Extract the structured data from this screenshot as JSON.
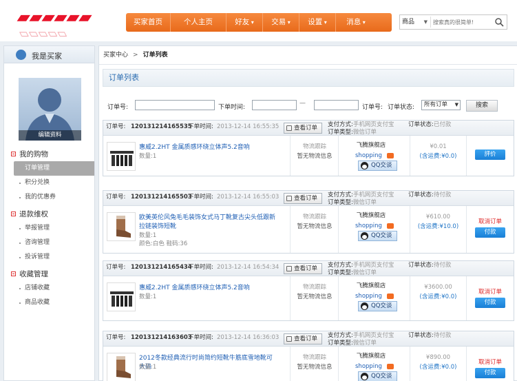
{
  "header": {
    "nav": [
      {
        "label": "买家首页",
        "dropdown": false
      },
      {
        "label": "个人主页",
        "dropdown": false
      },
      {
        "label": "好友",
        "dropdown": true
      },
      {
        "label": "交易",
        "dropdown": true
      },
      {
        "label": "设置",
        "dropdown": true
      },
      {
        "label": "消息",
        "dropdown": true
      }
    ],
    "search": {
      "scope": "商品",
      "placeholder": "搜索真的很简单!"
    }
  },
  "sidebar": {
    "title": "我是买家",
    "avatar_edit": "编辑资料",
    "groups": [
      {
        "label": "我的购物",
        "items": [
          "订单管理",
          "积分兑换",
          "我的优惠券"
        ]
      },
      {
        "label": "退款维权",
        "items": [
          "举报管理",
          "咨询管理",
          "投诉管理"
        ]
      },
      {
        "label": "收藏管理",
        "items": [
          "店铺收藏",
          "商品收藏"
        ]
      }
    ]
  },
  "breadcrumb": {
    "parent": "买家中心",
    "separator": ">",
    "current": "订单列表"
  },
  "page_title": "订单列表",
  "filter": {
    "order_no_label": "订单号:",
    "time_label": "下单时间:",
    "range_sep": "—",
    "order_no2_label": "订单号:",
    "status_label": "订单状态:",
    "status_value": "所有订单",
    "search_button": "搜索"
  },
  "labels": {
    "order_no": "订单号:",
    "order_time": "下单时间:",
    "view_order": "查看订单",
    "pay_method": "支付方式:",
    "order_type": "订单类型:",
    "order_status": "订单状态:",
    "logistics_track": "物流跟踪",
    "no_logistics": "暂无物流信息",
    "qq": "QQ交谈",
    "shopping": "shopping",
    "qty_prefix": "数量:",
    "cancel": "取消订单",
    "pay": "付款",
    "extra_action": "評价"
  },
  "orders": [
    {
      "no": "120131214165535",
      "time": "2013-12-14 16:55:35",
      "pay": "手机网页支付宝",
      "type": "微信订单",
      "status": "已付款",
      "product": "惠威2.2HT 金属质感环绕立体声5.2音响",
      "qty": "1",
      "extra": "",
      "shop": "飞腾旗舰店",
      "price": "¥0.01",
      "shipping": "(含运费:¥0.0)",
      "state": "paid"
    },
    {
      "no": "120131214165503",
      "time": "2013-12-14 16:55:03",
      "pay": "手机网页支付宝",
      "type": "微信订单",
      "status": "待付款",
      "product": "欧美英伦风兔毛毛装饰女式马丁靴复古尖头低跟新拉链装饰短靴",
      "qty": "1",
      "extra": "颜色:白色 鞋码:36",
      "shop": "飞腾旗舰店",
      "price": "¥610.00",
      "shipping": "(含运费:¥10.0)",
      "state": "unpaid"
    },
    {
      "no": "120131214165434",
      "time": "2013-12-14 16:54:34",
      "pay": "手机网页支付宝",
      "type": "微信订单",
      "status": "待付款",
      "product": "惠威2.2HT 金属质感环绕立体声5.2音响",
      "qty": "1",
      "extra": "",
      "shop": "飞腾旗舰店",
      "price": "¥3600.00",
      "shipping": "(含运费:¥0.0)",
      "state": "unpaid"
    },
    {
      "no": "120131214163603",
      "time": "2013-12-14 16:36:03",
      "pay": "手机网页支付宝",
      "type": "微信订单",
      "status": "待付款",
      "product": "2012冬款经典流行时尚简约短靴牛筋底雪地靴可大码",
      "qty": "1",
      "extra": "",
      "shop": "飞腾旗舰店",
      "price": "¥890.00",
      "shipping": "(含运费:¥0.0)",
      "state": "unpaid"
    }
  ],
  "colors": {
    "nav_orange": "#f07a2c",
    "link_blue": "#1f5fb4",
    "cancel_red": "#dd2222",
    "pay_blue": "#1a7fd6"
  }
}
